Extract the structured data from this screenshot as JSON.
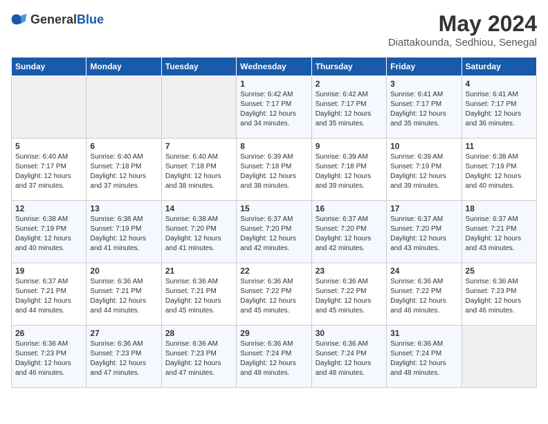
{
  "header": {
    "logo_general": "General",
    "logo_blue": "Blue",
    "month": "May 2024",
    "location": "Diattakounda, Sedhiou, Senegal"
  },
  "days_of_week": [
    "Sunday",
    "Monday",
    "Tuesday",
    "Wednesday",
    "Thursday",
    "Friday",
    "Saturday"
  ],
  "weeks": [
    [
      {
        "day": "",
        "sunrise": "",
        "sunset": "",
        "daylight": "",
        "empty": true
      },
      {
        "day": "",
        "sunrise": "",
        "sunset": "",
        "daylight": "",
        "empty": true
      },
      {
        "day": "",
        "sunrise": "",
        "sunset": "",
        "daylight": "",
        "empty": true
      },
      {
        "day": "1",
        "sunrise": "Sunrise: 6:42 AM",
        "sunset": "Sunset: 7:17 PM",
        "daylight": "Daylight: 12 hours and 34 minutes."
      },
      {
        "day": "2",
        "sunrise": "Sunrise: 6:42 AM",
        "sunset": "Sunset: 7:17 PM",
        "daylight": "Daylight: 12 hours and 35 minutes."
      },
      {
        "day": "3",
        "sunrise": "Sunrise: 6:41 AM",
        "sunset": "Sunset: 7:17 PM",
        "daylight": "Daylight: 12 hours and 35 minutes."
      },
      {
        "day": "4",
        "sunrise": "Sunrise: 6:41 AM",
        "sunset": "Sunset: 7:17 PM",
        "daylight": "Daylight: 12 hours and 36 minutes."
      }
    ],
    [
      {
        "day": "5",
        "sunrise": "Sunrise: 6:40 AM",
        "sunset": "Sunset: 7:17 PM",
        "daylight": "Daylight: 12 hours and 37 minutes."
      },
      {
        "day": "6",
        "sunrise": "Sunrise: 6:40 AM",
        "sunset": "Sunset: 7:18 PM",
        "daylight": "Daylight: 12 hours and 37 minutes."
      },
      {
        "day": "7",
        "sunrise": "Sunrise: 6:40 AM",
        "sunset": "Sunset: 7:18 PM",
        "daylight": "Daylight: 12 hours and 38 minutes."
      },
      {
        "day": "8",
        "sunrise": "Sunrise: 6:39 AM",
        "sunset": "Sunset: 7:18 PM",
        "daylight": "Daylight: 12 hours and 38 minutes."
      },
      {
        "day": "9",
        "sunrise": "Sunrise: 6:39 AM",
        "sunset": "Sunset: 7:18 PM",
        "daylight": "Daylight: 12 hours and 39 minutes."
      },
      {
        "day": "10",
        "sunrise": "Sunrise: 6:39 AM",
        "sunset": "Sunset: 7:19 PM",
        "daylight": "Daylight: 12 hours and 39 minutes."
      },
      {
        "day": "11",
        "sunrise": "Sunrise: 6:38 AM",
        "sunset": "Sunset: 7:19 PM",
        "daylight": "Daylight: 12 hours and 40 minutes."
      }
    ],
    [
      {
        "day": "12",
        "sunrise": "Sunrise: 6:38 AM",
        "sunset": "Sunset: 7:19 PM",
        "daylight": "Daylight: 12 hours and 40 minutes."
      },
      {
        "day": "13",
        "sunrise": "Sunrise: 6:38 AM",
        "sunset": "Sunset: 7:19 PM",
        "daylight": "Daylight: 12 hours and 41 minutes."
      },
      {
        "day": "14",
        "sunrise": "Sunrise: 6:38 AM",
        "sunset": "Sunset: 7:20 PM",
        "daylight": "Daylight: 12 hours and 41 minutes."
      },
      {
        "day": "15",
        "sunrise": "Sunrise: 6:37 AM",
        "sunset": "Sunset: 7:20 PM",
        "daylight": "Daylight: 12 hours and 42 minutes."
      },
      {
        "day": "16",
        "sunrise": "Sunrise: 6:37 AM",
        "sunset": "Sunset: 7:20 PM",
        "daylight": "Daylight: 12 hours and 42 minutes."
      },
      {
        "day": "17",
        "sunrise": "Sunrise: 6:37 AM",
        "sunset": "Sunset: 7:20 PM",
        "daylight": "Daylight: 12 hours and 43 minutes."
      },
      {
        "day": "18",
        "sunrise": "Sunrise: 6:37 AM",
        "sunset": "Sunset: 7:21 PM",
        "daylight": "Daylight: 12 hours and 43 minutes."
      }
    ],
    [
      {
        "day": "19",
        "sunrise": "Sunrise: 6:37 AM",
        "sunset": "Sunset: 7:21 PM",
        "daylight": "Daylight: 12 hours and 44 minutes."
      },
      {
        "day": "20",
        "sunrise": "Sunrise: 6:36 AM",
        "sunset": "Sunset: 7:21 PM",
        "daylight": "Daylight: 12 hours and 44 minutes."
      },
      {
        "day": "21",
        "sunrise": "Sunrise: 6:36 AM",
        "sunset": "Sunset: 7:21 PM",
        "daylight": "Daylight: 12 hours and 45 minutes."
      },
      {
        "day": "22",
        "sunrise": "Sunrise: 6:36 AM",
        "sunset": "Sunset: 7:22 PM",
        "daylight": "Daylight: 12 hours and 45 minutes."
      },
      {
        "day": "23",
        "sunrise": "Sunrise: 6:36 AM",
        "sunset": "Sunset: 7:22 PM",
        "daylight": "Daylight: 12 hours and 45 minutes."
      },
      {
        "day": "24",
        "sunrise": "Sunrise: 6:36 AM",
        "sunset": "Sunset: 7:22 PM",
        "daylight": "Daylight: 12 hours and 46 minutes."
      },
      {
        "day": "25",
        "sunrise": "Sunrise: 6:36 AM",
        "sunset": "Sunset: 7:23 PM",
        "daylight": "Daylight: 12 hours and 46 minutes."
      }
    ],
    [
      {
        "day": "26",
        "sunrise": "Sunrise: 6:36 AM",
        "sunset": "Sunset: 7:23 PM",
        "daylight": "Daylight: 12 hours and 46 minutes."
      },
      {
        "day": "27",
        "sunrise": "Sunrise: 6:36 AM",
        "sunset": "Sunset: 7:23 PM",
        "daylight": "Daylight: 12 hours and 47 minutes."
      },
      {
        "day": "28",
        "sunrise": "Sunrise: 6:36 AM",
        "sunset": "Sunset: 7:23 PM",
        "daylight": "Daylight: 12 hours and 47 minutes."
      },
      {
        "day": "29",
        "sunrise": "Sunrise: 6:36 AM",
        "sunset": "Sunset: 7:24 PM",
        "daylight": "Daylight: 12 hours and 48 minutes."
      },
      {
        "day": "30",
        "sunrise": "Sunrise: 6:36 AM",
        "sunset": "Sunset: 7:24 PM",
        "daylight": "Daylight: 12 hours and 48 minutes."
      },
      {
        "day": "31",
        "sunrise": "Sunrise: 6:36 AM",
        "sunset": "Sunset: 7:24 PM",
        "daylight": "Daylight: 12 hours and 48 minutes."
      },
      {
        "day": "",
        "sunrise": "",
        "sunset": "",
        "daylight": "",
        "empty": true
      }
    ]
  ]
}
